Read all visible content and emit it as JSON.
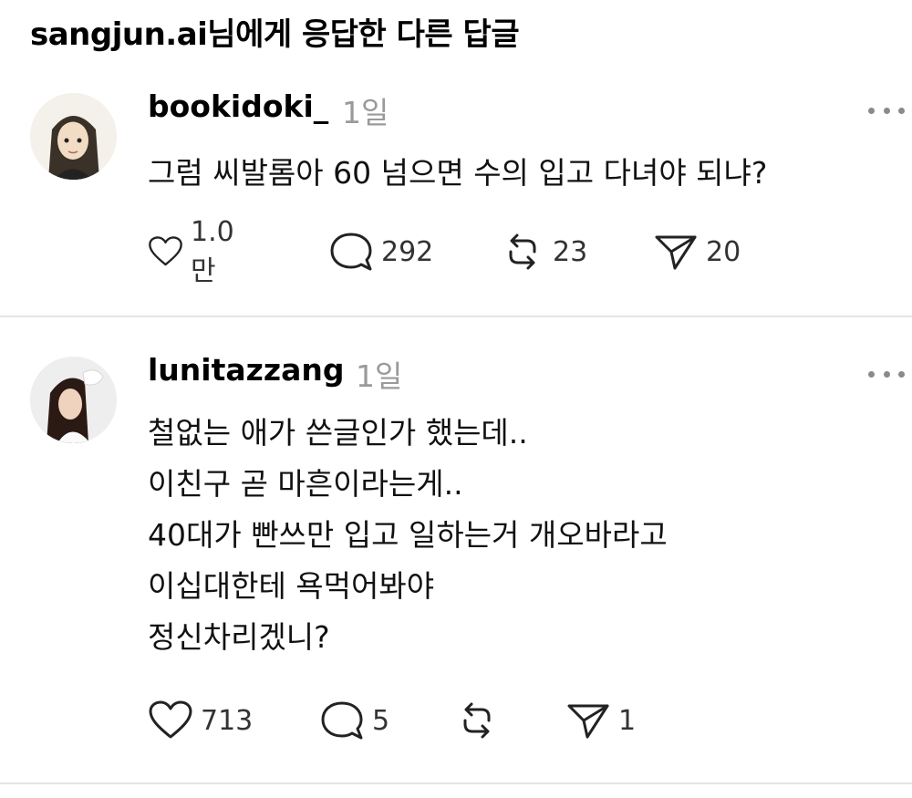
{
  "header": {
    "title": "sangjun.ai님에게 응답한 다른 답글"
  },
  "posts": [
    {
      "username": "bookidoki_",
      "time": "1일",
      "lines": [
        "그럼 씨발롬아 60 넘으면 수의 입고 다녀야 되냐?"
      ],
      "likes": "1.0만",
      "comments": "292",
      "reposts": "23",
      "shares": "20"
    },
    {
      "username": "lunitazzang",
      "time": "1일",
      "lines": [
        "철없는 애가 쓴글인가 했는데..",
        "이친구 곧 마흔이라는게..",
        "40대가 빤쓰만 입고 일하는거 개오바라고",
        "이십대한테 욕먹어봐야",
        "정신차리겠니?"
      ],
      "likes": "713",
      "comments": "5",
      "reposts": "",
      "shares": "1"
    }
  ],
  "icons": {
    "like": "heart-icon",
    "comment": "comment-bubble-icon",
    "repost": "repost-icon",
    "share": "send-icon",
    "more": "more-dots-icon"
  }
}
